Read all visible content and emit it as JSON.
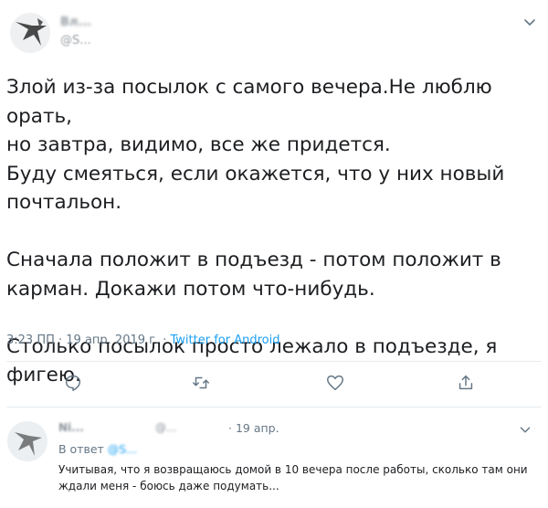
{
  "tweet": {
    "author_name": "Вл...",
    "author_handle": "@S...",
    "paragraphs": [
      "Злой из-за посылок с самого вечера.Не люблю орать,\nно завтра, видимо, все же придется.\nБуду смеяться, если окажется, что у них новый\nпочтальон.",
      "Сначала положит в подъезд - потом положит в\nкарман. Докажи потом что-нибудь.",
      "Столько посылок просто лежало в подъезде, я фигею."
    ],
    "time": "3:23 ПП · 19 апр. 2019 г. · ",
    "source": "Twitter for Android",
    "icons": {
      "reply": "reply-icon",
      "retweet": "retweet-icon",
      "like": "heart-icon",
      "share": "share-icon",
      "more": "chevron-down-icon"
    },
    "colors": {
      "accent": "#1da1f2",
      "muted": "#657786",
      "text": "#1c1e21"
    }
  },
  "reply": {
    "author_name": "Ni...",
    "author_handle": "@...",
    "date": "· 19 апр.",
    "to_prefix": "В ответ ",
    "to_handle": "@S...",
    "text": "Учитывая, что я возвращаюсь домой в 10 вечера после работы, сколько там они ждали меня - боюсь даже подумать..."
  }
}
